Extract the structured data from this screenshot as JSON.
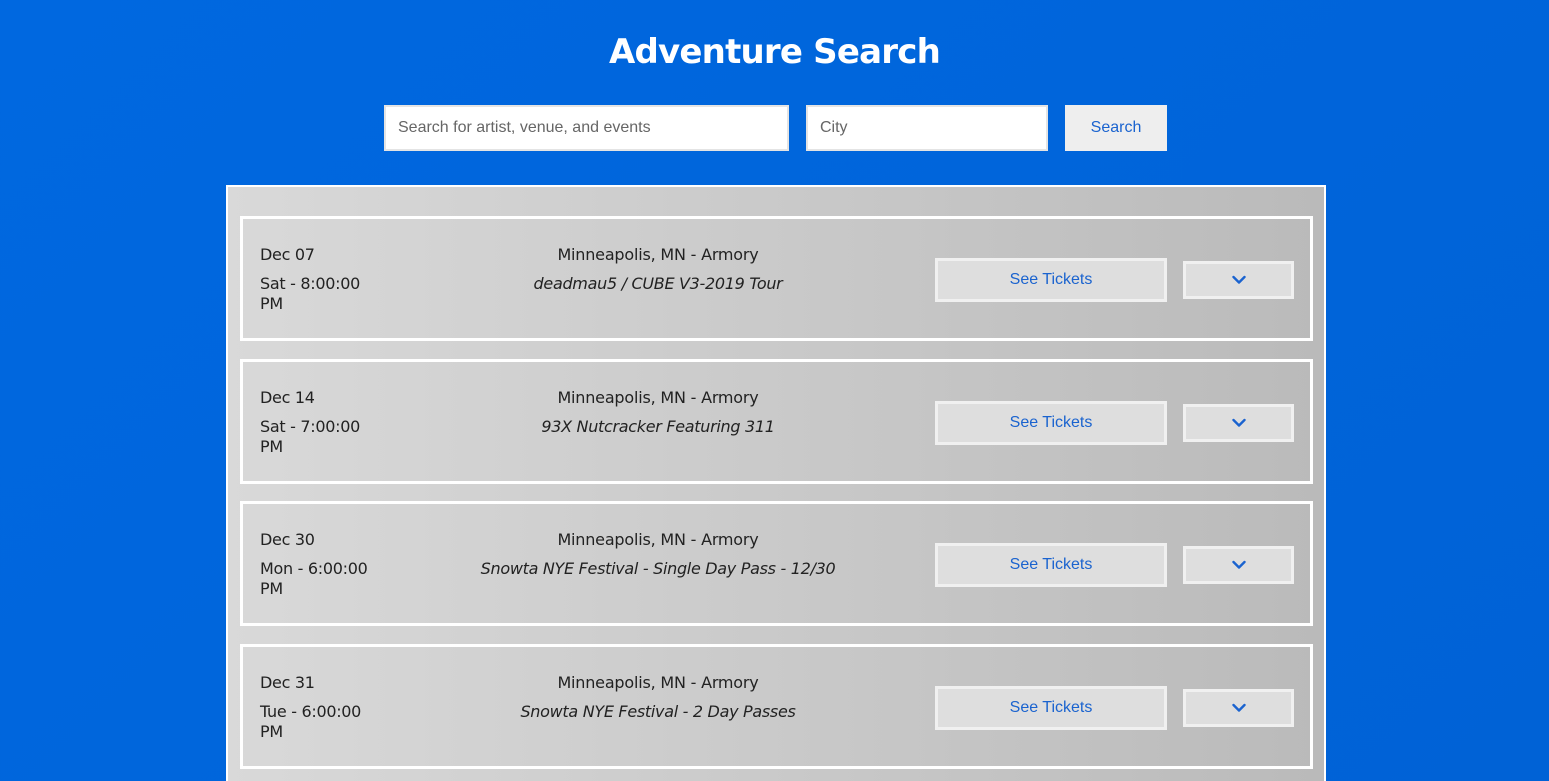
{
  "header": {
    "title": "Adventure Search"
  },
  "search": {
    "query_placeholder": "Search for artist, venue, and events",
    "query_value": "",
    "city_placeholder": "City",
    "city_value": "",
    "button_label": "Search"
  },
  "events": [
    {
      "date": "Dec 07",
      "time": "Sat - 8:00:00 PM",
      "venue": "Minneapolis, MN - Armory",
      "name": "deadmau5 / CUBE V3-2019 Tour",
      "tickets_label": "See Tickets",
      "expand_icon": "chevron-down-icon"
    },
    {
      "date": "Dec 14",
      "time": "Sat - 7:00:00 PM",
      "venue": "Minneapolis, MN - Armory",
      "name": "93X Nutcracker Featuring 311",
      "tickets_label": "See Tickets",
      "expand_icon": "chevron-down-icon"
    },
    {
      "date": "Dec 30",
      "time": "Mon - 6:00:00 PM",
      "venue": "Minneapolis, MN - Armory",
      "name": "Snowta NYE Festival - Single Day Pass - 12/30",
      "tickets_label": "See Tickets",
      "expand_icon": "chevron-down-icon"
    },
    {
      "date": "Dec 31",
      "time": "Tue - 6:00:00 PM",
      "venue": "Minneapolis, MN - Armory",
      "name": "Snowta NYE Festival - 2 Day Passes",
      "tickets_label": "See Tickets",
      "expand_icon": "chevron-down-icon"
    }
  ],
  "colors": {
    "background": "#0066dd",
    "accent_text": "#1a63cf",
    "card_border": "#ffffff"
  }
}
